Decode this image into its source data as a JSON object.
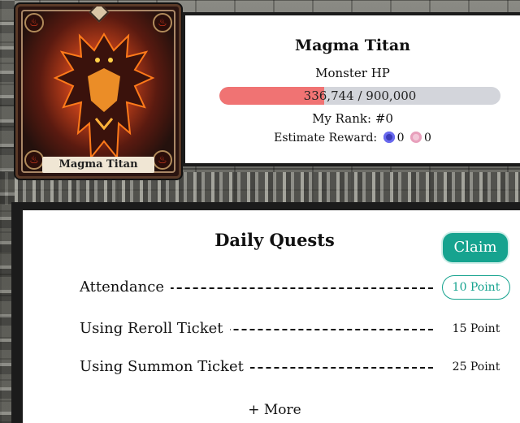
{
  "card": {
    "name": "Magma Titan"
  },
  "boss": {
    "name": "Magma Titan",
    "hp_label": "Monster HP",
    "hp_text": "336,744 / 900,000",
    "hp_fraction": 0.374,
    "rank_text": "My Rank: #0",
    "reward_label": "Estimate Reward:",
    "reward_coin": "0",
    "reward_other": "0"
  },
  "quests": {
    "title": "Daily Quests",
    "claim_label": "Claim",
    "items": [
      {
        "label": "Attendance",
        "points": "10 Point",
        "active": true
      },
      {
        "label": "Using Reroll Ticket",
        "points": "15 Point",
        "active": false
      },
      {
        "label": "Using Summon Ticket",
        "points": "25 Point",
        "active": false
      }
    ],
    "more_label": "+ More"
  },
  "colors": {
    "accent": "#16a38f",
    "hp_fill": "#f07373",
    "hp_track": "#d3d5db"
  }
}
